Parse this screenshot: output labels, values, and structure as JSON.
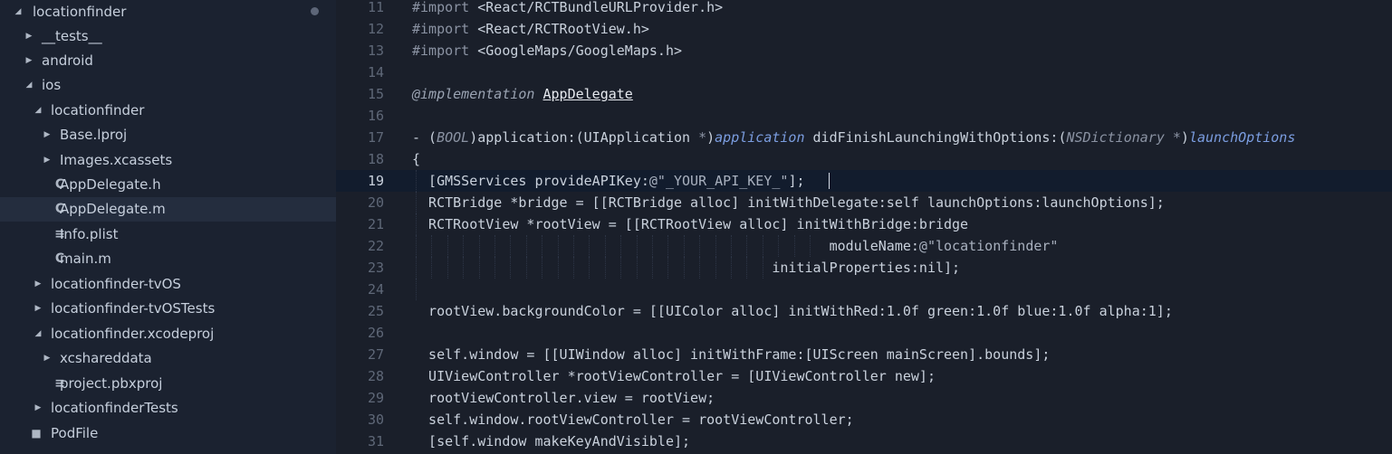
{
  "sidebar": {
    "items": [
      {
        "label": "locationfinder",
        "kind": "folder-open",
        "icon": "chevron-down-icon",
        "depth": 0
      },
      {
        "label": "__tests__",
        "kind": "folder",
        "icon": "chevron-right-icon",
        "depth": 1
      },
      {
        "label": "android",
        "kind": "folder",
        "icon": "chevron-right-icon",
        "depth": 1
      },
      {
        "label": "ios",
        "kind": "folder-open",
        "icon": "chevron-down-icon",
        "depth": 1
      },
      {
        "label": "locationfinder",
        "kind": "folder-open",
        "icon": "chevron-down-icon",
        "depth": 2
      },
      {
        "label": "Base.lproj",
        "kind": "folder",
        "icon": "chevron-right-icon",
        "depth": 3
      },
      {
        "label": "Images.xcassets",
        "kind": "folder",
        "icon": "chevron-right-icon",
        "depth": 3
      },
      {
        "label": "AppDelegate.h",
        "kind": "file-c",
        "icon": "c-file-icon",
        "depth": 3
      },
      {
        "label": "AppDelegate.m",
        "kind": "file-c",
        "icon": "c-file-icon",
        "depth": 3,
        "selected": true
      },
      {
        "label": "Info.plist",
        "kind": "file-text",
        "icon": "text-file-icon",
        "depth": 3
      },
      {
        "label": "main.m",
        "kind": "file-c",
        "icon": "c-file-icon",
        "depth": 3
      },
      {
        "label": "locationfinder-tvOS",
        "kind": "folder",
        "icon": "chevron-right-icon",
        "depth": 2
      },
      {
        "label": "locationfinder-tvOSTests",
        "kind": "folder",
        "icon": "chevron-right-icon",
        "depth": 2
      },
      {
        "label": "locationfinder.xcodeproj",
        "kind": "folder-open",
        "icon": "chevron-down-icon",
        "depth": 2
      },
      {
        "label": "xcshareddata",
        "kind": "folder",
        "icon": "chevron-right-icon",
        "depth": 3
      },
      {
        "label": "project.pbxproj",
        "kind": "file-text",
        "icon": "text-file-icon",
        "depth": 3
      },
      {
        "label": "locationfinderTests",
        "kind": "folder",
        "icon": "chevron-right-icon",
        "depth": 2
      },
      {
        "label": "PodFile",
        "kind": "file-other",
        "icon": "file-icon",
        "depth": 2
      }
    ]
  },
  "editor": {
    "lines": [
      {
        "num": "11",
        "code": "#import <React/RCTBundleURLProvider.h>"
      },
      {
        "num": "12",
        "code": "#import <React/RCTRootView.h>"
      },
      {
        "num": "13",
        "code": "#import <GoogleMaps/GoogleMaps.h>"
      },
      {
        "num": "14",
        "code": ""
      },
      {
        "num": "15",
        "code": "@implementation AppDelegate"
      },
      {
        "num": "16",
        "code": ""
      },
      {
        "num": "17",
        "code": "- (BOOL)application:(UIApplication *)application didFinishLaunchingWithOptions:(NSDictionary *)launchOptions"
      },
      {
        "num": "18",
        "code": "{"
      },
      {
        "num": "19",
        "code": "  [GMSServices provideAPIKey:@\"_YOUR_API_KEY_\"];",
        "current": true
      },
      {
        "num": "20",
        "code": "  RCTBridge *bridge = [[RCTBridge alloc] initWithDelegate:self launchOptions:launchOptions];"
      },
      {
        "num": "21",
        "code": "  RCTRootView *rootView = [[RCTRootView alloc] initWithBridge:bridge"
      },
      {
        "num": "22",
        "code": "                                                   moduleName:@\"locationfinder\""
      },
      {
        "num": "23",
        "code": "                                            initialProperties:nil];"
      },
      {
        "num": "24",
        "code": ""
      },
      {
        "num": "25",
        "code": "  rootView.backgroundColor = [[UIColor alloc] initWithRed:1.0f green:1.0f blue:1.0f alpha:1];"
      },
      {
        "num": "26",
        "code": ""
      },
      {
        "num": "27",
        "code": "  self.window = [[UIWindow alloc] initWithFrame:[UIScreen mainScreen].bounds];"
      },
      {
        "num": "28",
        "code": "  UIViewController *rootViewController = [UIViewController new];"
      },
      {
        "num": "29",
        "code": "  rootViewController.view = rootView;"
      },
      {
        "num": "30",
        "code": "  self.window.rootViewController = rootViewController;"
      },
      {
        "num": "31",
        "code": "  [self.window makeKeyAndVisible];"
      }
    ]
  },
  "colors": {
    "sidebar_bg": "#1b2230",
    "editor_bg": "#1a1f2a",
    "selected_row": "#242d3e",
    "current_line": "#121c2d",
    "param": "#7b9de0"
  }
}
